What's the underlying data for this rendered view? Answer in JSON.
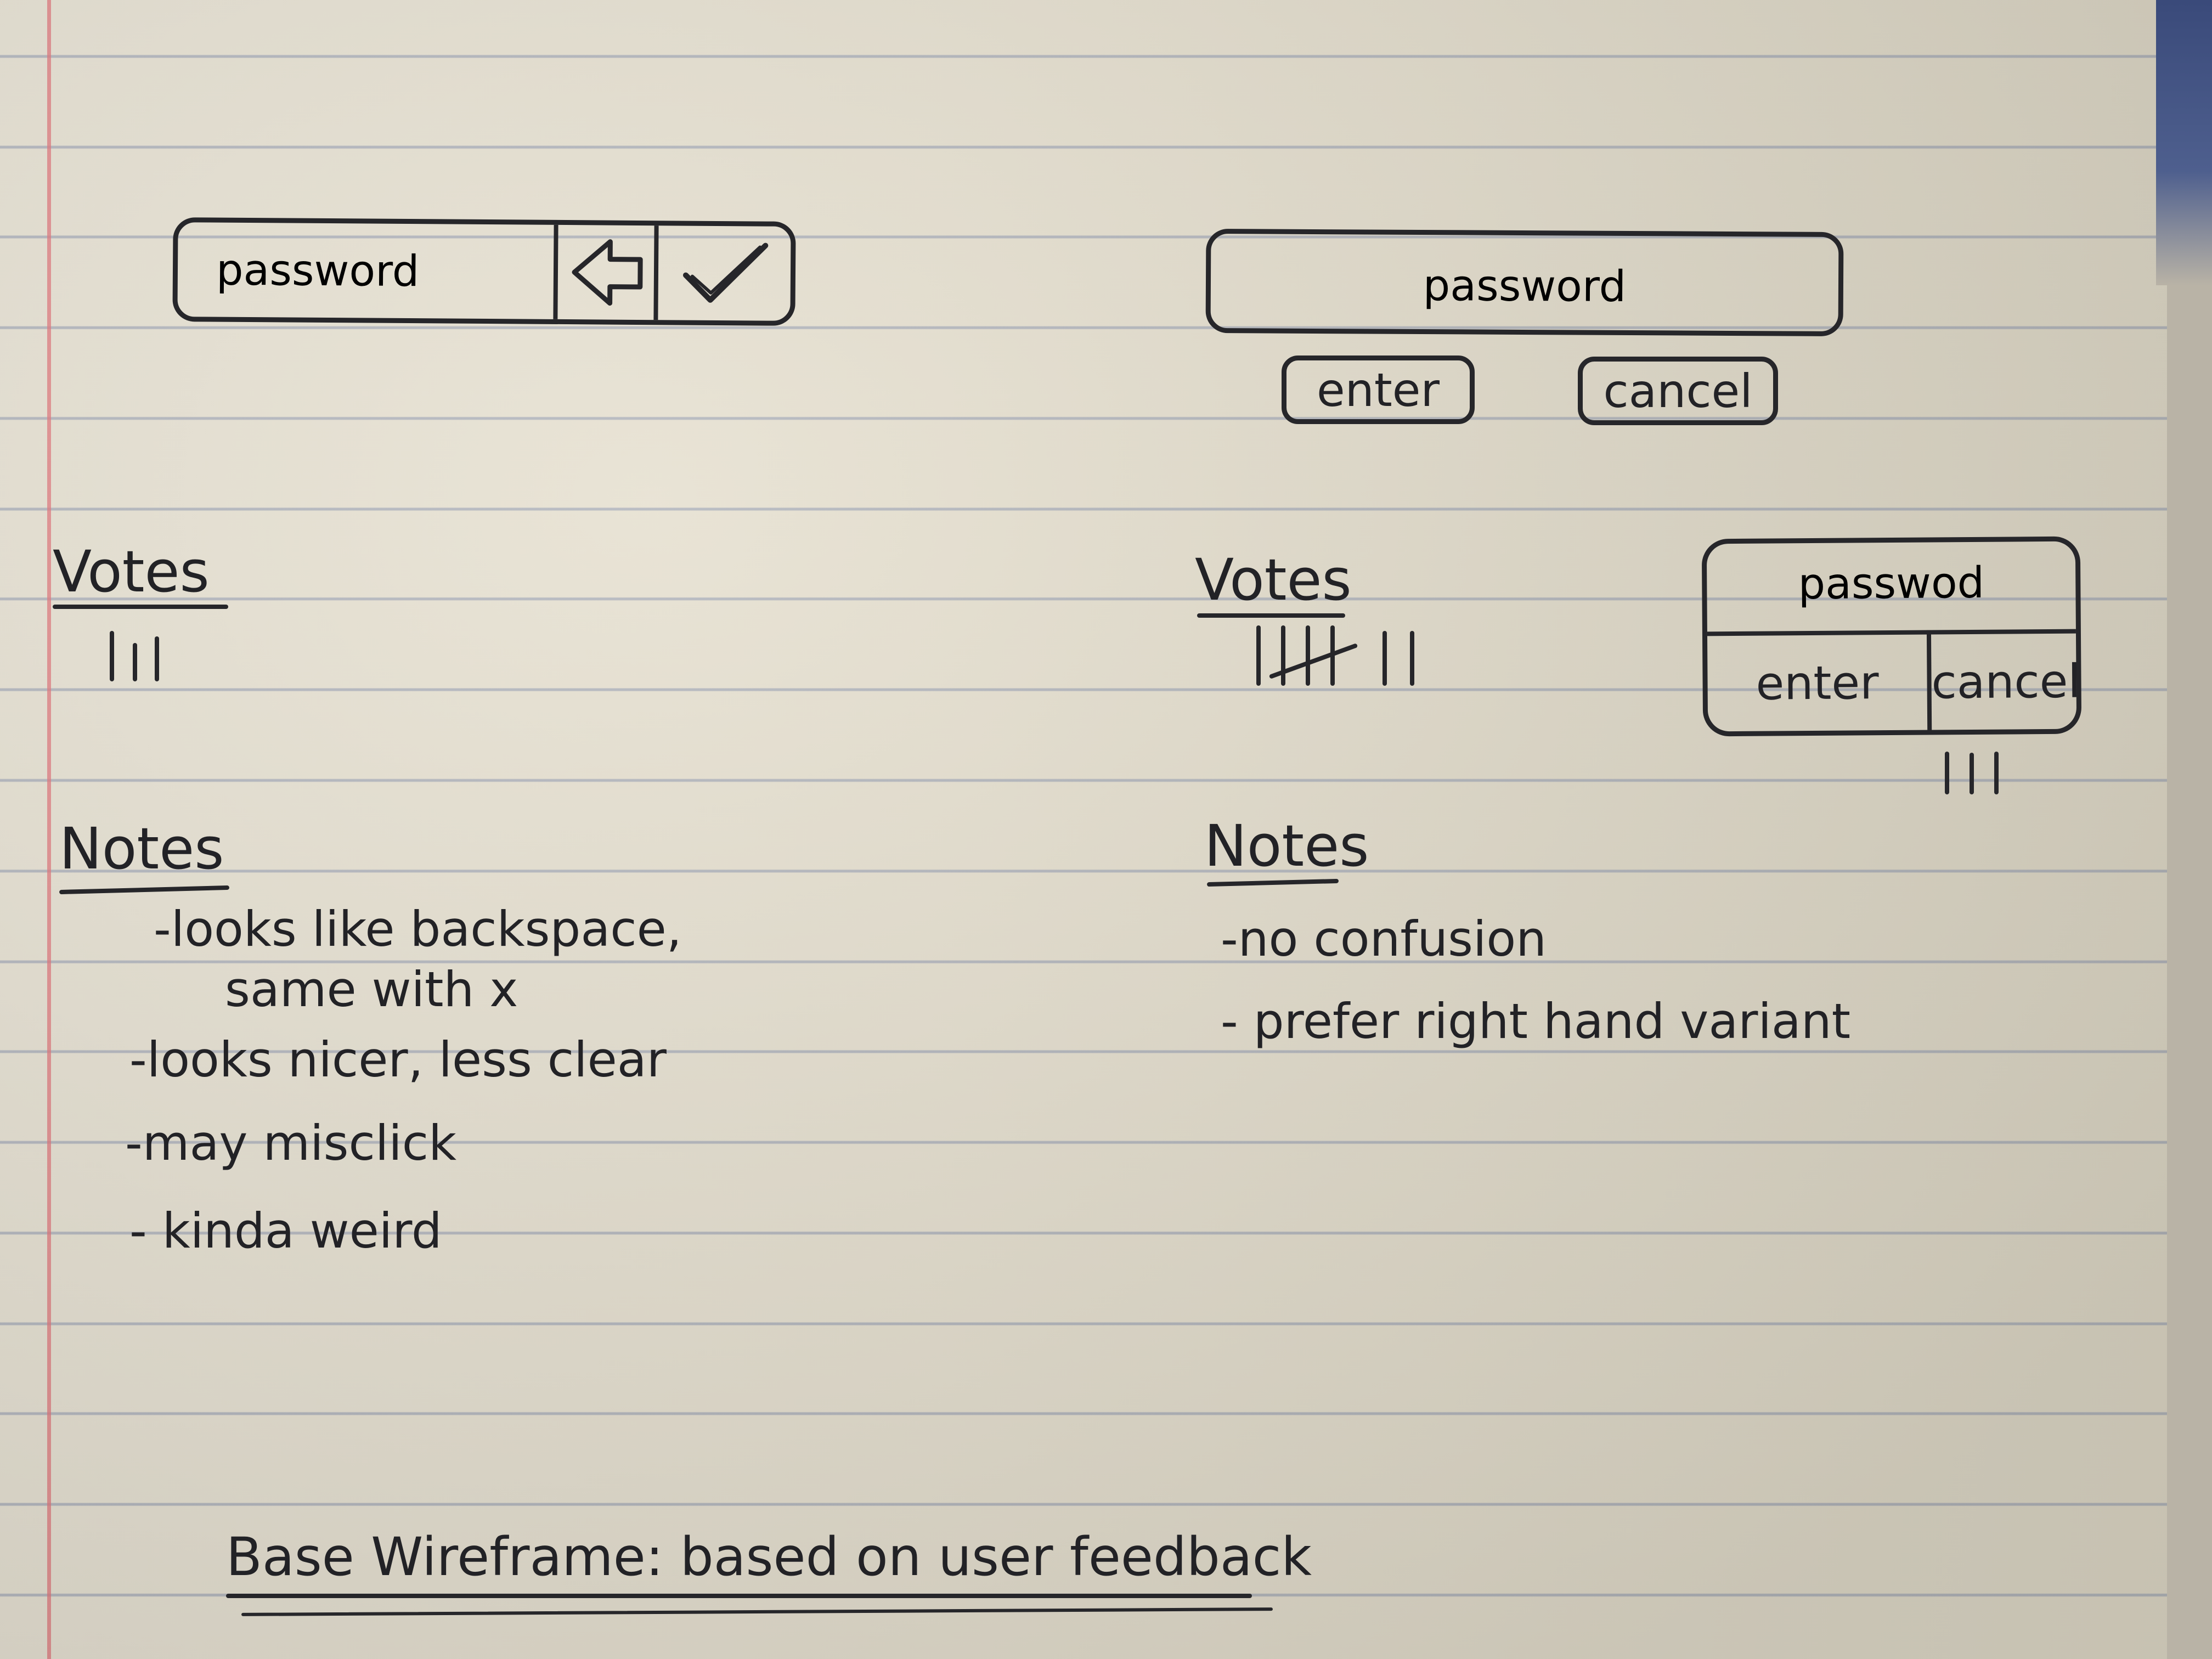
{
  "variant_a": {
    "field_label": "password",
    "back_icon": "back-arrow-icon",
    "confirm_icon": "checkmark-icon",
    "votes_heading": "Votes",
    "votes_count": 3,
    "notes_heading": "Notes",
    "notes": [
      "-looks like backspace,",
      "same with x",
      "-looks nicer, less clear",
      "-may misclick",
      "- kinda weird"
    ]
  },
  "variant_b": {
    "field_label": "password",
    "enter_label": "enter",
    "cancel_label": "cancel",
    "votes_heading": "Votes",
    "votes_count": 7,
    "notes_heading": "Notes",
    "notes": [
      "-no confusion",
      "- prefer right hand variant"
    ]
  },
  "variant_c": {
    "field_label": "passwod",
    "enter_label": "enter",
    "cancel_label": "cancel",
    "votes_count": 3
  },
  "footer": {
    "caption": "Base Wireframe: based on user feedback"
  },
  "colors": {
    "ink": "#26262a",
    "paper": "#e6e0d0",
    "rule": "#8c96af",
    "margin": "#e1787d"
  }
}
